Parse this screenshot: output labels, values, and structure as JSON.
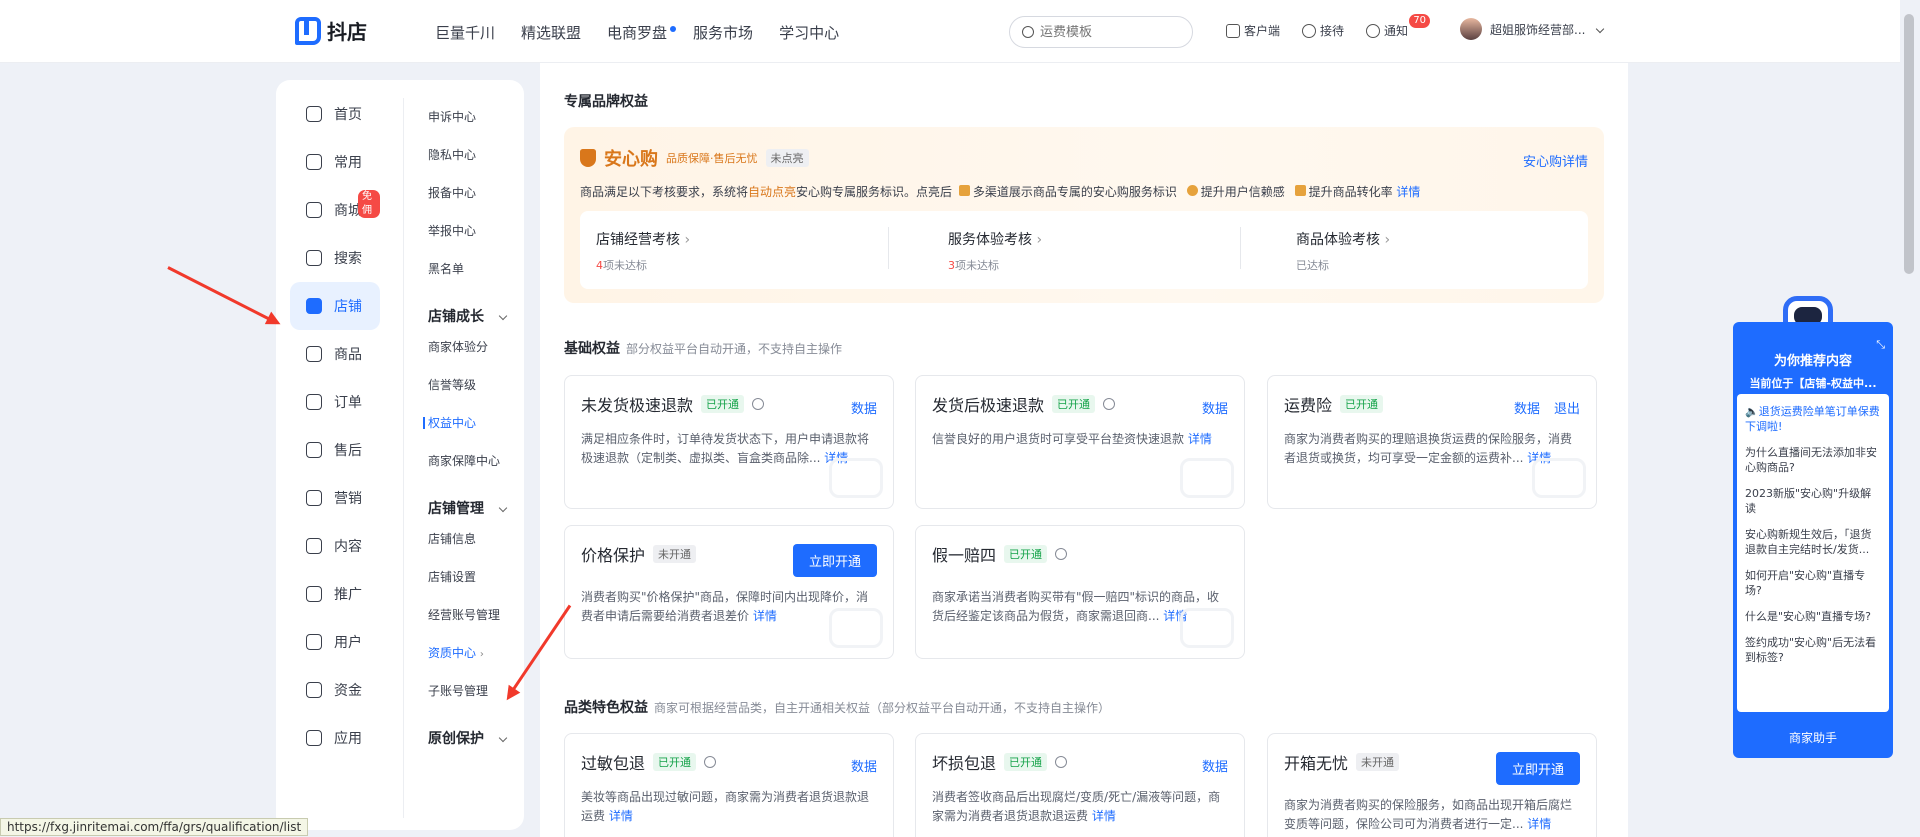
{
  "topbar": {
    "logo": "抖店",
    "nav": [
      "巨量千川",
      "精选联盟",
      "电商罗盘",
      "服务市场",
      "学习中心"
    ],
    "search_placeholder": "运费模板",
    "actions": {
      "client": "客户端",
      "reception": "接待",
      "notify": "通知",
      "notify_count": "70"
    },
    "user_name": "超姐服饰经营部..."
  },
  "sidebar": {
    "primary": [
      {
        "label": "首页"
      },
      {
        "label": "常用"
      },
      {
        "label": "商城",
        "badge": "免佣"
      },
      {
        "label": "搜索"
      },
      {
        "label": "店铺",
        "active": true
      },
      {
        "label": "商品"
      },
      {
        "label": "订单"
      },
      {
        "label": "售后"
      },
      {
        "label": "营销"
      },
      {
        "label": "内容"
      },
      {
        "label": "推广"
      },
      {
        "label": "用户"
      },
      {
        "label": "资金"
      },
      {
        "label": "应用"
      }
    ],
    "secondary": {
      "top_items": [
        "申诉中心",
        "隐私中心",
        "报备中心",
        "举报中心",
        "黑名单"
      ],
      "group1": "店铺成长",
      "group1_items": [
        "商家体验分",
        "信誉等级",
        "权益中心",
        "商家保障中心"
      ],
      "group2": "店铺管理",
      "group2_items": [
        "店铺信息",
        "店铺设置",
        "经营账号管理",
        "资质中心",
        "子账号管理"
      ],
      "group3": "原创保护"
    }
  },
  "main": {
    "brand_section": "专属品牌权益",
    "anxin": {
      "name": "安心购",
      "tagline": "品质保障·售后无忧",
      "status": "未点亮",
      "link": "安心购详情",
      "desc_1": "商品满足以下考核要求，系统将",
      "desc_auto": "自动点亮",
      "desc_2": "安心购专属服务标识。点亮后",
      "desc_3": "多渠道展示商品专属的安心购服务标识",
      "desc_4": "提升用户信赖感",
      "desc_5": "提升商品转化率",
      "desc_link": "详情",
      "checks": [
        {
          "title": "店铺经营考核",
          "count": "4",
          "suffix": "项未达标"
        },
        {
          "title": "服务体验考核",
          "count": "3",
          "suffix": "项未达标"
        },
        {
          "title": "商品体验考核",
          "count": "",
          "suffix": "已达标"
        }
      ]
    },
    "basic": {
      "title": "基础权益",
      "sub": "部分权益平台自动开通，不支持自主操作",
      "cards": [
        {
          "name": "未发货极速退款",
          "status": "已开通",
          "ops": [
            "数据"
          ],
          "desc": "满足相应条件时，订单待发货状态下，用户申请退款将极速退款（定制类、虚拟类、盲盒类商品除...",
          "link": "详情"
        },
        {
          "name": "发货后极速退款",
          "status": "已开通",
          "ops": [
            "数据"
          ],
          "desc": "信誉良好的用户退货时可享受平台垫资快速退款",
          "link": "详情"
        },
        {
          "name": "运费险",
          "status": "已开通",
          "ops": [
            "数据",
            "退出"
          ],
          "desc": "商家为消费者购买的理赔退换货运费的保险服务，消费者退货或换货，均可享受一定金额的运费补...",
          "link": "详情"
        },
        {
          "name": "价格保护",
          "status": "未开通",
          "button": "立即开通",
          "desc": "消费者购买\"价格保护\"商品，保障时间内出现降价，消费者申请后需要给消费者退差价",
          "link": "详情"
        },
        {
          "name": "假一赔四",
          "status": "已开通",
          "desc": "商家承诺当消费者购买带有\"假一赔四\"标识的商品，收货后经鉴定该商品为假货，商家需退回商...",
          "link": "详情"
        }
      ]
    },
    "category": {
      "title": "品类特色权益",
      "sub": "商家可根据经营品类，自主开通相关权益（部分权益平台自动开通，不支持自主操作）",
      "cards": [
        {
          "name": "过敏包退",
          "status": "已开通",
          "ops": [
            "数据"
          ],
          "desc": "美妆等商品出现过敏问题，商家需为消费者退货退款退运费",
          "link": "详情"
        },
        {
          "name": "坏损包退",
          "status": "已开通",
          "ops": [
            "数据"
          ],
          "desc": "消费者签收商品后出现腐烂/变质/死亡/漏液等问题，商家需为消费者退货退款退运费",
          "link": "详情"
        },
        {
          "name": "开箱无忧",
          "status": "未开通",
          "button": "立即开通",
          "desc": "商家为消费者购买的保险服务，如商品出现开箱后腐烂变质等问题，保险公司可为消费者进行一定...",
          "link": "详情"
        }
      ]
    }
  },
  "helper": {
    "title": "为你推荐内容",
    "location": "当前位于【店铺-权益中...",
    "items": [
      "退货运费险单笔订单保费下调啦!",
      "为什么直播间无法添加非安心购商品?",
      "2023新版\"安心购\"升级解读",
      "安心购新规生效后，「退货退款自主完结时长/发货...",
      "如何开启\"安心购\"直播专场?",
      "什么是\"安心购\"直播专场?",
      "签约成功\"安心购\"后无法看到标签?"
    ],
    "footer": "商家助手"
  },
  "status_url": "https://fxg.jinritemai.com/ffa/grs/qualification/list",
  "colors": {
    "brand": "#1e6cff",
    "anxin": "#d9771b",
    "alert": "#f54a45",
    "success": "#16a34a"
  }
}
